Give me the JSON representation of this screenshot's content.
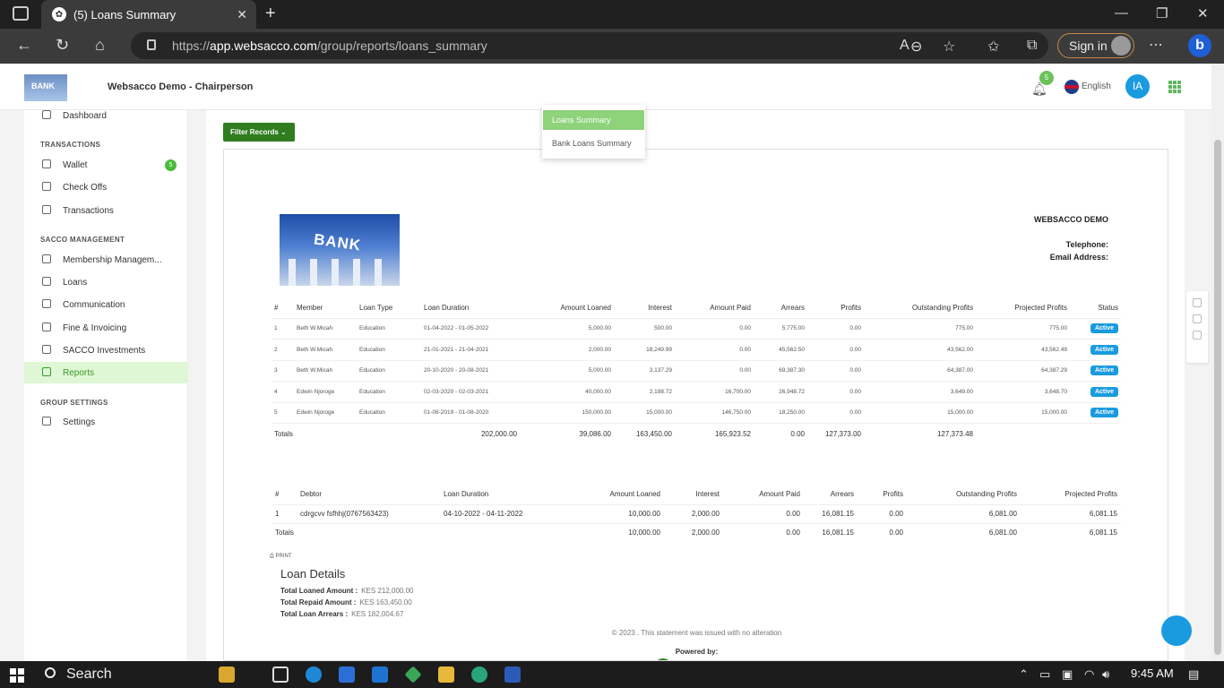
{
  "browser": {
    "tab_title": "(5) Loans Summary",
    "url_prefix": "https://",
    "url_host": "app.websacco.com",
    "url_path": "/group/reports/loans_summary",
    "sign_in": "Sign in"
  },
  "header": {
    "logo_text": "BANK",
    "title": "Websacco Demo - Chairperson",
    "notif_count": "5",
    "language": "English",
    "user_initials": "IA"
  },
  "sidebar": {
    "dashboard": "Dashboard",
    "sec_transactions": "TRANSACTIONS",
    "wallet": "Wallet",
    "wallet_badge": "5",
    "checkoffs": "Check Offs",
    "transactions": "Transactions",
    "sec_sacco": "SACCO MANAGEMENT",
    "membership": "Membership Managem...",
    "loans": "Loans",
    "communication": "Communication",
    "fine": "Fine & Invoicing",
    "investments": "SACCO Investments",
    "reports": "Reports",
    "sec_group": "GROUP SETTINGS",
    "settings": "Settings"
  },
  "filter": {
    "button": "Filter Records",
    "options": [
      "Loans Summary",
      "Bank Loans Summary"
    ]
  },
  "report": {
    "logo_text": "BANK",
    "company": "WEBSACCO DEMO",
    "telephone": "Telephone:",
    "email": "Email Address:",
    "headers": [
      "#",
      "Member",
      "Loan Type",
      "Loan Duration",
      "Amount Loaned",
      "Interest",
      "Amount Paid",
      "Arrears",
      "Profits",
      "Outstanding Profits",
      "Projected Profits",
      "Status"
    ],
    "rows": [
      [
        "1",
        "Beth W.Micah",
        "Education",
        "01-04-2022 - 01-05-2022",
        "5,000.00",
        "500.00",
        "0.00",
        "5,775.00",
        "0.00",
        "775.00",
        "775.00",
        "Active"
      ],
      [
        "2",
        "Beth W.Micah",
        "Education",
        "21-01-2021 - 21-04-2021",
        "2,000.00",
        "18,249.99",
        "0.00",
        "45,562.50",
        "0.00",
        "43,562.00",
        "43,562.49",
        "Active"
      ],
      [
        "3",
        "Beth W.Micah",
        "Education",
        "20-10-2020 - 20-08-2021",
        "5,000.00",
        "3,137.29",
        "0.00",
        "69,387.30",
        "0.00",
        "64,387.00",
        "64,387.29",
        "Active"
      ],
      [
        "4",
        "Edwin Njoroge",
        "Education",
        "02-03-2020 - 02-03-2021",
        "40,000.00",
        "2,198.72",
        "16,700.00",
        "26,948.72",
        "0.00",
        "3,649.00",
        "3,648.70",
        "Active"
      ],
      [
        "5",
        "Edwin Njoroge",
        "Education",
        "01-08-2019 - 01-08-2020",
        "150,000.00",
        "15,000.00",
        "146,750.00",
        "18,250.00",
        "0.00",
        "15,000.00",
        "15,000.00",
        "Active"
      ]
    ],
    "totals_label": "Totals",
    "totals": [
      "202,000.00",
      "39,086.00",
      "163,450.00",
      "165,923.52",
      "0.00",
      "127,373.00",
      "127,373.48"
    ]
  },
  "debtors": {
    "headers": [
      "#",
      "Debtor",
      "Loan Duration",
      "Amount Loaned",
      "Interest",
      "Amount Paid",
      "Arrears",
      "Profits",
      "Outstanding Profits",
      "Projected Profits"
    ],
    "rows": [
      [
        "1",
        "cdrgcvv fsfhhj(0767563423)",
        "04-10-2022 - 04-11-2022",
        "10,000.00",
        "2,000.00",
        "0.00",
        "16,081.15",
        "0.00",
        "6,081.00",
        "6,081.15"
      ]
    ],
    "totals_label": "Totals",
    "totals": [
      "10,000.00",
      "2,000.00",
      "0.00",
      "16,081.15",
      "0.00",
      "6,081.00",
      "6,081.15"
    ]
  },
  "details": {
    "print": "PRINT",
    "title": "Loan Details",
    "total_loaned_label": "Total Loaned Amount :",
    "total_loaned": "KES 212,000.00",
    "total_repaid_label": "Total Repaid Amount :",
    "total_repaid": "KES 163,450.00",
    "total_arrears_label": "Total Loan Arrears :",
    "total_arrears": "KES 182,004.67",
    "copyright": "© 2023 . This statement was issued with no alteration",
    "powered": "Powered by:"
  },
  "taskbar": {
    "search": "Search",
    "time": "9:45 AM"
  }
}
